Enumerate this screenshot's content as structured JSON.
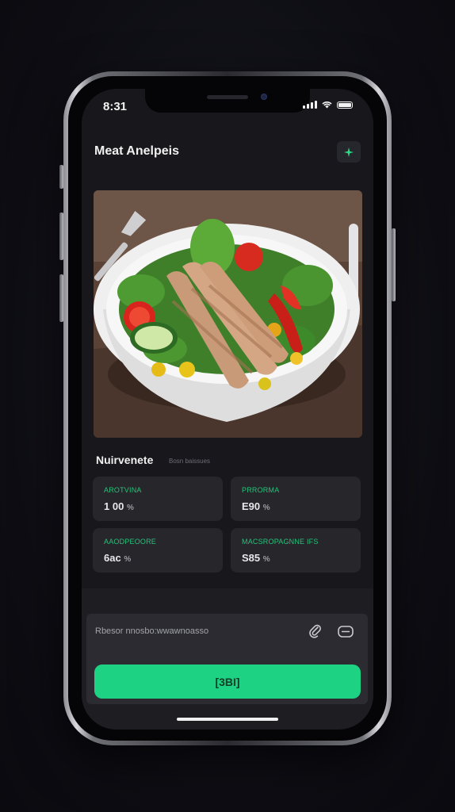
{
  "status_bar": {
    "time": "8:31",
    "icons": [
      "cellular-signal-icon",
      "wifi-icon",
      "battery-icon"
    ]
  },
  "header": {
    "title": "Meat Anelpeis",
    "action_icon": "sparkle-icon"
  },
  "meal_image": {
    "subject": "bowl of salad with sliced grilled chicken, tomatoes, cucumber, peppers and lettuce"
  },
  "nutrients": {
    "title": "Nuirvenete",
    "subtitle": "Bosn baissues",
    "cards": [
      {
        "label": "AROTVINA",
        "value": "1 00",
        "unit": "%"
      },
      {
        "label": "PRRORMA",
        "value": "E90",
        "unit": "%"
      },
      {
        "label": "AAODPEOORE",
        "value": "6ac",
        "unit": "%"
      },
      {
        "label": "MACSROPAGNNE IFS",
        "value": "S85",
        "unit": "%"
      }
    ]
  },
  "input": {
    "placeholder": "Rbesor nnosbo:wwawnoasso",
    "attach_icon": "paperclip-icon",
    "mic_icon": "camera-icon"
  },
  "primary_button": {
    "label": "[3BI]"
  },
  "colors": {
    "accent": "#1ed283",
    "label_green": "#27c27b",
    "screen_bg": "#17171c",
    "card_bg": "#26262b"
  }
}
